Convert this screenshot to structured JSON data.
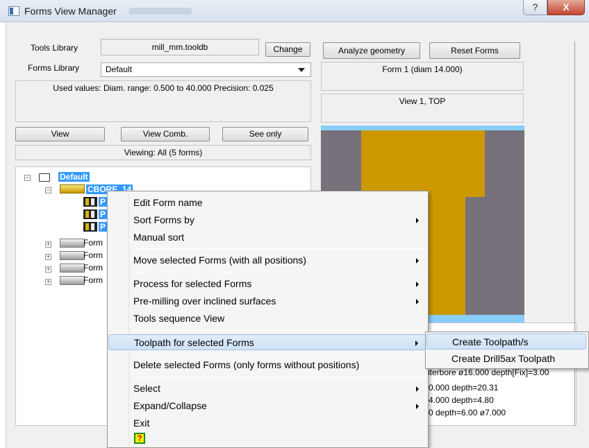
{
  "window": {
    "title": "Forms View Manager",
    "help_label": "?",
    "close_label": "X"
  },
  "tools_library": {
    "label": "Tools Library",
    "value": "mill_mm.tooldb",
    "change_label": "Change"
  },
  "forms_library": {
    "label": "Forms Library",
    "selected": "Default"
  },
  "used_values": "Used values:  Diam. range: 0.500 to 40.000  Precision: 0.025",
  "view_buttons": {
    "view": "View",
    "view_comb": "View Comb.",
    "see_only": "See only"
  },
  "viewing_status": "Viewing: All (5 forms)",
  "right_buttons": {
    "analyze": "Analyze geometry",
    "reset": "Reset Forms"
  },
  "form_title": "Form 1 (diam 14.000)",
  "view_title": "View 1,  TOP",
  "tree": {
    "root": "Default",
    "cbore": "CBORE_14",
    "positions": [
      "P",
      "P",
      "P"
    ],
    "forms": [
      "Form",
      "Form",
      "Form",
      "Form"
    ]
  },
  "info_lines": [
    "nterbore ø16.000 depth[Fix]=3.00",
    "0.000 depth=20.31",
    "4.000 depth=4.80",
    "0 depth=6.00 ø7.000"
  ],
  "context_menu": {
    "items": [
      {
        "label": "Edit Form name",
        "submenu": false
      },
      {
        "label": "Sort Forms by",
        "submenu": true
      },
      {
        "label": "Manual sort",
        "submenu": false
      },
      {
        "label": "Move selected Forms (with all positions)",
        "submenu": true
      },
      {
        "label": "Process for selected Forms",
        "submenu": true
      },
      {
        "label": "Pre-milling over inclined surfaces",
        "submenu": true
      },
      {
        "label": "Tools sequence View",
        "submenu": false
      },
      {
        "label": "Toolpath for selected Forms",
        "submenu": true
      },
      {
        "label": "Delete selected Forms (only forms without positions)",
        "submenu": false
      },
      {
        "label": "Select",
        "submenu": true
      },
      {
        "label": "Expand/Collapse",
        "submenu": true
      },
      {
        "label": "Exit",
        "submenu": false
      }
    ],
    "help_icon": "?"
  },
  "submenu": {
    "items": [
      "Create Toolpath/s",
      "Create Drill5ax Toolpath"
    ]
  },
  "colors": {
    "preview_bg": "#76717a",
    "gold": "#cc9900",
    "light_blue": "#87cefa",
    "selection": "#3399ff"
  }
}
